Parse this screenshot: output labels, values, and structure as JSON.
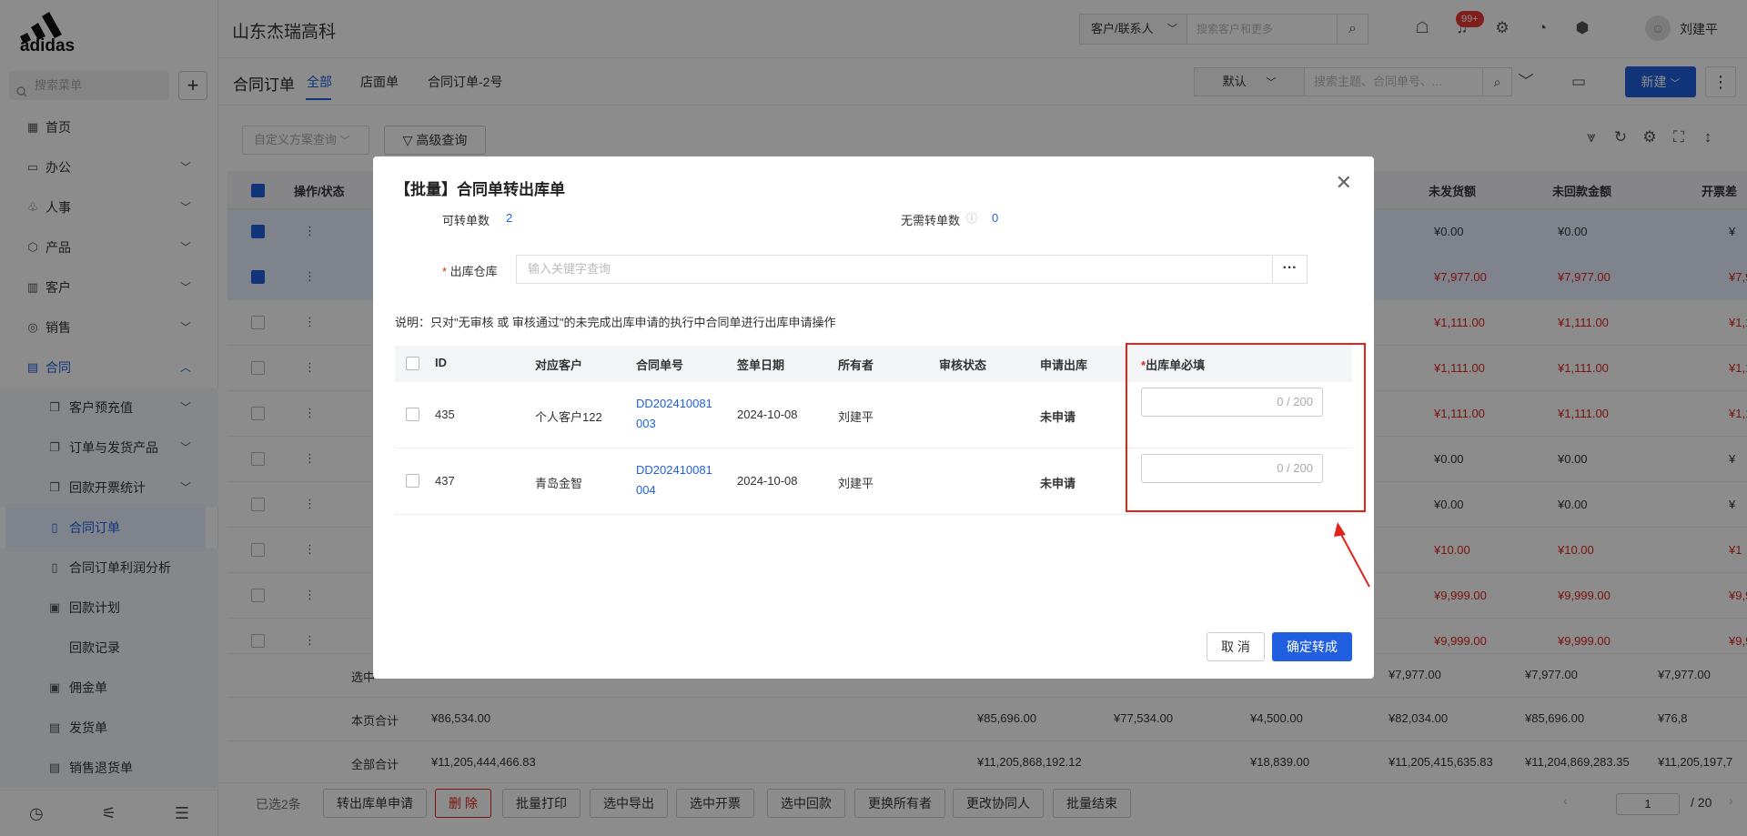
{
  "brand": {
    "logo_text": "adidas",
    "company": "山东杰瑞高科"
  },
  "sidebar": {
    "search_placeholder": "搜索菜单",
    "add_icon": "plus-icon",
    "items": [
      {
        "label": "首页",
        "icon": "home-icon"
      },
      {
        "label": "办公",
        "icon": "office-icon"
      },
      {
        "label": "人事",
        "icon": "hr-icon"
      },
      {
        "label": "产品",
        "icon": "product-icon"
      },
      {
        "label": "客户",
        "icon": "customer-icon"
      },
      {
        "label": "销售",
        "icon": "sales-icon"
      },
      {
        "label": "合同",
        "icon": "contract-icon"
      }
    ],
    "sub_items": [
      {
        "label": "客户预充值"
      },
      {
        "label": "订单与发货产品"
      },
      {
        "label": "回款开票统计"
      },
      {
        "label": "合同订单"
      },
      {
        "label": "合同订单利润分析"
      },
      {
        "label": "回款计划"
      },
      {
        "label": "回款记录"
      },
      {
        "label": "佣金单"
      },
      {
        "label": "发货单"
      },
      {
        "label": "销售退货单"
      }
    ]
  },
  "topbar": {
    "search_type": "客户/联系人",
    "search_placeholder": "搜索客户和更多",
    "notification_badge": "99+",
    "user_name": "刘建平"
  },
  "tabsbar": {
    "title": "合同订单",
    "tabs": [
      {
        "label": "全部"
      },
      {
        "label": "店面单"
      },
      {
        "label": "合同订单-2号"
      }
    ],
    "view": "默认",
    "search_placeholder": "搜索主题、合同单号、...",
    "new_label": "新建"
  },
  "filter": {
    "scheme_placeholder": "自定义方案查询",
    "advanced_label": "高级查询"
  },
  "table": {
    "headers": {
      "op": "操作/状态",
      "unshipped": "未发货额",
      "unpaid": "未回款金额",
      "invoice_diff": "开票差"
    },
    "rows": [
      {
        "unshipped": "¥0.00",
        "unpaid": "¥0.00",
        "diff": "¥",
        "selected": true,
        "red": false
      },
      {
        "unshipped": "¥7,977.00",
        "unpaid": "¥7,977.00",
        "diff": "¥7,9",
        "selected": true,
        "red": true
      },
      {
        "unshipped": "¥1,111.00",
        "unpaid": "¥1,111.00",
        "diff": "¥1,1",
        "selected": false,
        "red": true
      },
      {
        "unshipped": "¥1,111.00",
        "unpaid": "¥1,111.00",
        "diff": "¥1,1",
        "selected": false,
        "red": true
      },
      {
        "unshipped": "¥1,111.00",
        "unpaid": "¥1,111.00",
        "diff": "¥1,1",
        "selected": false,
        "red": true
      },
      {
        "unshipped": "¥0.00",
        "unpaid": "¥0.00",
        "diff": "¥",
        "selected": false,
        "red": false
      },
      {
        "unshipped": "¥0.00",
        "unpaid": "¥0.00",
        "diff": "¥",
        "selected": false,
        "red": false
      },
      {
        "unshipped": "¥10.00",
        "unpaid": "¥10.00",
        "diff": "¥1",
        "selected": false,
        "red": true
      },
      {
        "unshipped": "¥9,999.00",
        "unpaid": "¥9,999.00",
        "diff": "¥9,9",
        "selected": false,
        "red": true
      },
      {
        "unshipped": "¥9,999.00",
        "unpaid": "¥9,999.00",
        "diff": "¥9,9",
        "selected": false,
        "red": true
      }
    ],
    "footer": [
      {
        "label": "选中",
        "c1": "",
        "c2": "",
        "c3": "",
        "c4": "",
        "c5": "¥7,977.00",
        "c6": "¥7,977.00",
        "c7": "¥7,977.00"
      },
      {
        "label": "本页合计",
        "c1": "¥86,534.00",
        "c2": "¥85,696.00",
        "c3": "¥77,534.00",
        "c4": "¥4,500.00",
        "c5": "¥82,034.00",
        "c6": "¥85,696.00",
        "c7": "¥76,8"
      },
      {
        "label": "全部合计",
        "c1": "¥11,205,444,466.83",
        "c2": "¥11,205,868,192.12",
        "c3": "",
        "c4": "¥18,839.00",
        "c5": "¥11,205,415,635.83",
        "c6": "¥11,204,869,283.35",
        "c7": "¥11,205,197,7"
      }
    ]
  },
  "bottombar": {
    "selected_count": "已选2条",
    "buttons": [
      "转出库单申请",
      "删 除",
      "批量打印",
      "选中导出",
      "选中开票",
      "选中回款",
      "更换所有者",
      "更改协同人",
      "批量结束"
    ],
    "page_current": "1",
    "page_total": "/ 20"
  },
  "modal": {
    "title": "【批量】合同单转出库单",
    "convertible_label": "可转单数",
    "convertible_value": "2",
    "no_need_label": "无需转单数",
    "no_need_value": "0",
    "warehouse_label": "出库仓库",
    "warehouse_placeholder": "输入关键字查询",
    "note": "说明：只对\"无审核 或 审核通过\"的未完成出库申请的执行中合同单进行出库申请操作",
    "headers": {
      "id": "ID",
      "customer": "对应客户",
      "contract_no": "合同单号",
      "sign_date": "签单日期",
      "owner": "所有者",
      "audit": "审核状态",
      "apply": "申请出库",
      "out_required": "出库单必填"
    },
    "rows": [
      {
        "id": "435",
        "customer": "个人客户122",
        "contract_no_1": "DD202410081",
        "contract_no_2": "003",
        "sign_date": "2024-10-08",
        "owner": "刘建平",
        "audit": "",
        "apply": "未申请",
        "counter": "0 / 200"
      },
      {
        "id": "437",
        "customer": "青岛金智",
        "contract_no_1": "DD202410081",
        "contract_no_2": "004",
        "sign_date": "2024-10-08",
        "owner": "刘建平",
        "audit": "",
        "apply": "未申请",
        "counter": "0 / 200"
      }
    ],
    "cancel_label": "取 消",
    "confirm_label": "确定转成",
    "accent_color": "#1f5fe0",
    "required_color": "#e0241b"
  }
}
